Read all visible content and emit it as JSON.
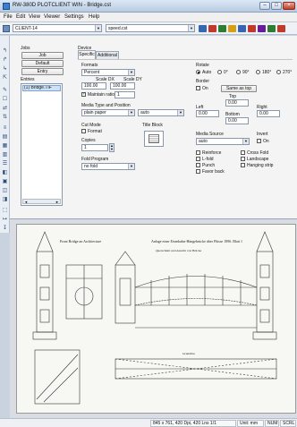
{
  "window": {
    "title": "RW-380D PLOTCLIENT WIN - Bridge.cst",
    "min": "–",
    "max": "□",
    "close": "×"
  },
  "menu": [
    "File",
    "Edit",
    "View",
    "Viewer",
    "Settings",
    "Help"
  ],
  "toolbar": {
    "client": "CLIENT-14",
    "speed_file": "speed.cst",
    "icon_colors": [
      "#3466b3",
      "#c0392b",
      "#2e7d32",
      "#d4a017",
      "#3466b3",
      "#c0392b",
      "#6a1b9a",
      "#2e7d32",
      "#c0392b"
    ]
  },
  "left_tools": [
    "↰",
    "↱",
    "↳",
    "⇱",
    "✎",
    "☐",
    "⇄",
    "⇅",
    "≡",
    "▤",
    "▦",
    "▥",
    "☰",
    "◧",
    "▣",
    "◫",
    "◨",
    "⬚",
    "↦",
    "↧"
  ],
  "job": {
    "section": "Jobs",
    "job_button": "Job",
    "default_button": "Default",
    "entry_button": "Entry",
    "entries_label": "Entries",
    "entries": [
      "(1) Bridge.TIF"
    ],
    "scroll_left": "◄",
    "scroll_right": "►"
  },
  "device": {
    "section": "Device",
    "tabs": [
      "Specific",
      "Additional"
    ]
  },
  "formats": {
    "label": "Formats",
    "value": "Percent",
    "scale_dx_label": "Scale DX",
    "scale_dy_label": "Scale DY",
    "scale_dx": "100.00",
    "scale_dy": "100.00",
    "maintain_ratio_label": "Maintain ratio",
    "maintain_ratio_value": "1"
  },
  "media": {
    "type_position_label": "Media Type and Position",
    "type": "plain paper",
    "position": "auto",
    "cut_mode_label": "Cut Mode",
    "cut_mode_option": "Format",
    "title_block_label": "Title Block",
    "copies_label": "Copies",
    "copies": "1",
    "fold_program_label": "Fold Program",
    "fold_program": "no fold",
    "source_label": "Media Source",
    "source": "auto"
  },
  "rotate": {
    "label": "Rotate",
    "options": [
      "Auto",
      "0°",
      "90°",
      "180°",
      "270°"
    ]
  },
  "border": {
    "label": "Border",
    "on_label": "On",
    "same_button": "Same as top",
    "top_label": "Top",
    "left_label": "Left",
    "right_label": "Right",
    "bottom_label": "Bottom",
    "top": "0.00",
    "left": "0.00",
    "right": "0.00",
    "bottom": "0.00"
  },
  "invert": {
    "label": "Invert",
    "on_label": "On"
  },
  "finishing": [
    "Reinforce",
    "L-fold",
    "Punch",
    "Favor back",
    "Cross Fold",
    "Landscape",
    "Hanging strip"
  ],
  "drawing": {
    "header_left": "Front Bridge an Architecture",
    "header_center": "Anlage einer Eisenbahn-Hängebrücke über Flüsse 1896. Blatt 1",
    "sub_center": "Querschnitt und Ansicht von Brücke",
    "bottom_center": "Grundriss"
  },
  "status": {
    "dims": "845 x 761, 420 Dpi, 420 Lns 1/1",
    "unit": "Unit: mm",
    "num": "NUM",
    "scrl": "SCRL"
  }
}
